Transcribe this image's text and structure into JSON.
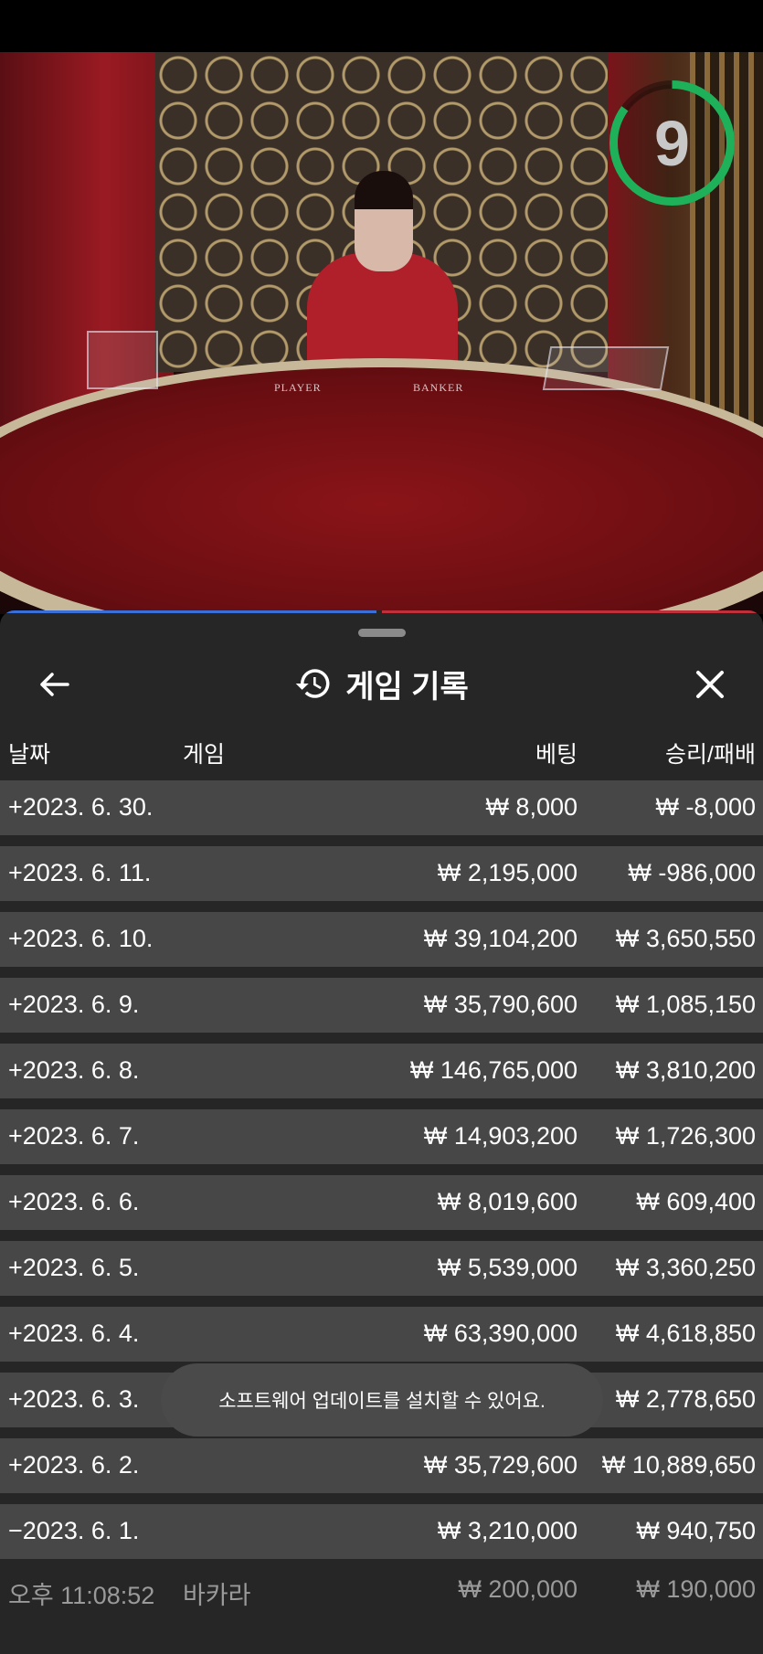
{
  "timer": {
    "value": "9",
    "progress": 0.85,
    "color": "#1fb05a"
  },
  "table_labels": {
    "player": "PLAYER",
    "banker": "BANKER"
  },
  "header": {
    "title": "게임 기록",
    "back_icon": "arrow-left-icon",
    "history_icon": "history-icon",
    "close_icon": "close-icon"
  },
  "columns": {
    "date": "날짜",
    "game": "게임",
    "bet": "베팅",
    "result": "승리/패배"
  },
  "rows": [
    {
      "date": "+2023. 6. 30.",
      "bet": "₩ 8,000",
      "result": "₩ -8,000"
    },
    {
      "date": "+2023. 6. 11.",
      "bet": "₩ 2,195,000",
      "result": "₩ -986,000"
    },
    {
      "date": "+2023. 6. 10.",
      "bet": "₩ 39,104,200",
      "result": "₩ 3,650,550"
    },
    {
      "date": "+2023. 6. 9.",
      "bet": "₩ 35,790,600",
      "result": "₩ 1,085,150"
    },
    {
      "date": "+2023. 6. 8.",
      "bet": "₩ 146,765,000",
      "result": "₩ 3,810,200"
    },
    {
      "date": "+2023. 6. 7.",
      "bet": "₩ 14,903,200",
      "result": "₩ 1,726,300"
    },
    {
      "date": "+2023. 6. 6.",
      "bet": "₩ 8,019,600",
      "result": "₩ 609,400"
    },
    {
      "date": "+2023. 6. 5.",
      "bet": "₩ 5,539,000",
      "result": "₩ 3,360,250"
    },
    {
      "date": "+2023. 6. 4.",
      "bet": "₩ 63,390,000",
      "result": "₩ 4,618,850"
    },
    {
      "date": "+2023. 6. 3.",
      "bet": "",
      "result": "₩ 2,778,650"
    },
    {
      "date": "+2023. 6. 2.",
      "bet": "₩ 35,729,600",
      "result": "₩ 10,889,650"
    },
    {
      "date": "−2023. 6. 1.",
      "bet": "₩ 3,210,000",
      "result": "₩ 940,750"
    }
  ],
  "detail_row": {
    "time": "오후 11:08:52",
    "game": "바카라",
    "bet": "₩ 200,000",
    "result": "₩ 190,000"
  },
  "toast": {
    "text": "소프트웨어 업데이트를 설치할 수 있어요."
  }
}
